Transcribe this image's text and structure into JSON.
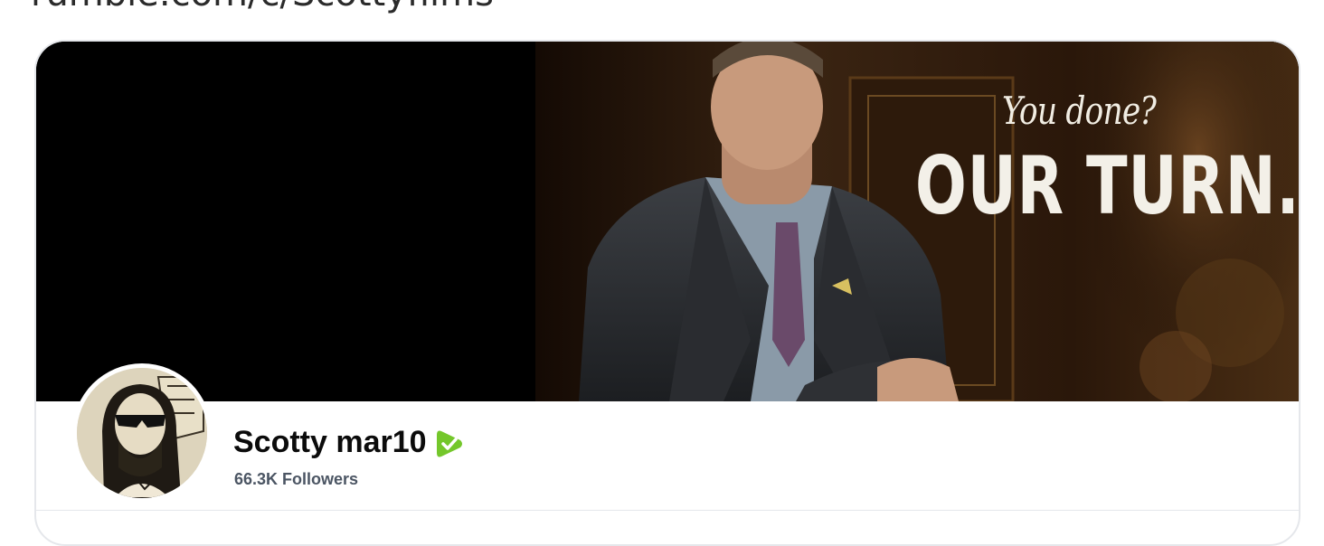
{
  "url_bar": {
    "text": "rumble.com/c/Scottyfilms"
  },
  "banner": {
    "tagline_small": "You done?",
    "tagline_large": "OUR TURN."
  },
  "channel": {
    "name": "Scotty mar10",
    "followers": "66.3K Followers",
    "verified": true
  },
  "icons": {
    "verified": "verified-check-icon",
    "avatar": "channel-avatar"
  },
  "colors": {
    "verified_green": "#74c72b",
    "name_text": "#0b0b0b",
    "followers_text": "#4b5563",
    "card_border": "#e5e7eb"
  }
}
